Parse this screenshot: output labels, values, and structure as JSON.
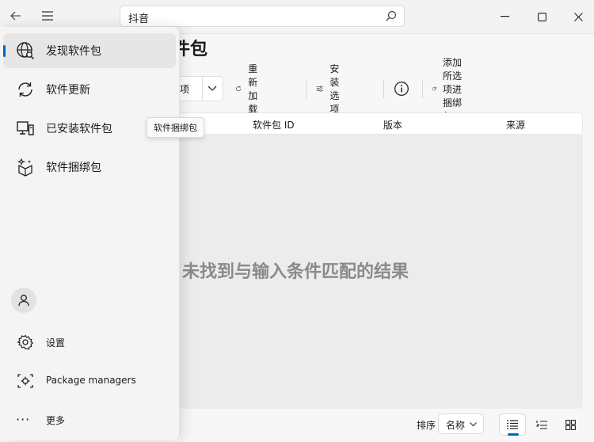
{
  "titlebar": {
    "search_value": "抖音"
  },
  "page": {
    "title": "件包"
  },
  "toolbar": {
    "selector_label": "选项",
    "reload": "重新加载",
    "install_options": "安装选项",
    "add_to_bundle": "添加所选项进捆绑包"
  },
  "table": {
    "col_id": "软件包 ID",
    "col_version": "版本",
    "col_source": "来源"
  },
  "empty_message": "未找到与输入条件匹配的结果",
  "sort": {
    "label": "排序",
    "value": "名称"
  },
  "tooltip": "软件捆绑包",
  "nav": {
    "items": [
      {
        "label": "发现软件包",
        "icon": "globe-search-icon"
      },
      {
        "label": "软件更新",
        "icon": "refresh-icon"
      },
      {
        "label": "已安装软件包",
        "icon": "desktop-icon"
      },
      {
        "label": "软件捆绑包",
        "icon": "sparkle-box-icon"
      }
    ],
    "settings": "设置",
    "package_managers": "Package managers",
    "more": "更多",
    "more_icon_glyph": "···"
  },
  "colors": {
    "accent": "#0067c0"
  }
}
